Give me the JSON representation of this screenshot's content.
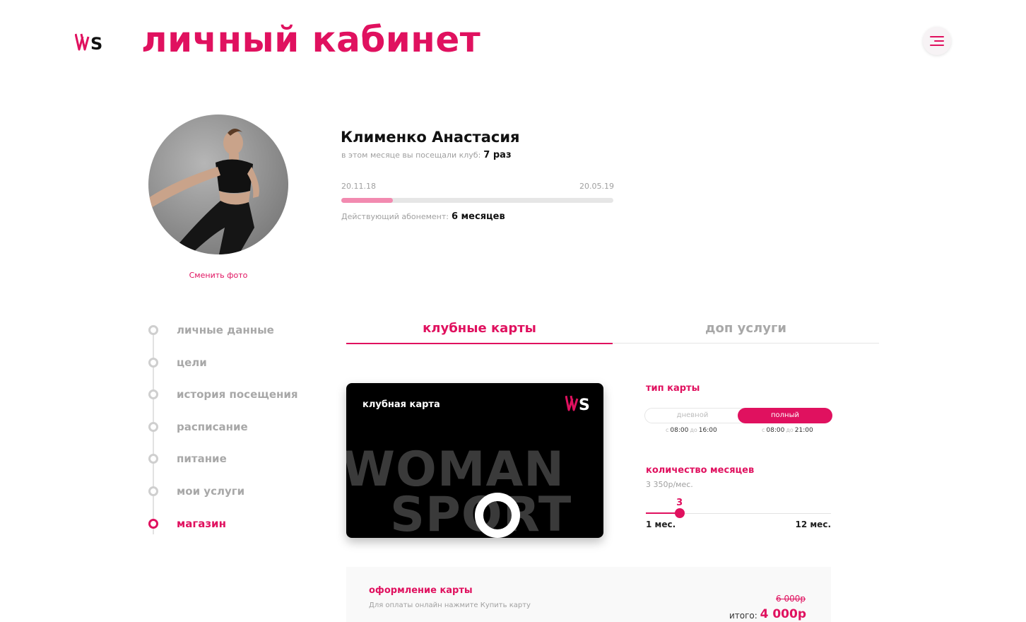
{
  "header": {
    "title": "личный кабинет",
    "logo_text": "WS"
  },
  "colors": {
    "accent": "#e0115f",
    "muted": "#a8a8a8",
    "progress_fill": "#f28ab0"
  },
  "profile": {
    "change_photo": "Сменить фото",
    "name": "Клименко Анастасия",
    "visits_label": "в этом месяце вы посещали клуб:",
    "visits_value": "7 раз",
    "date_start": "20.11.18",
    "date_end": "20.05.19",
    "progress_fraction": 0.19,
    "subscription_label": "Действующий абонемент:",
    "subscription_value": "6 месяцев"
  },
  "sidebar": {
    "items": [
      {
        "label": "личные данные",
        "active": false
      },
      {
        "label": "цели",
        "active": false
      },
      {
        "label": "история посещения",
        "active": false
      },
      {
        "label": "расписание",
        "active": false
      },
      {
        "label": "питание",
        "active": false
      },
      {
        "label": "мои услуги",
        "active": false
      },
      {
        "label": "магазин",
        "active": true
      }
    ]
  },
  "tabs": {
    "club_cards": "клубные карты",
    "extra_services": "доп услуги"
  },
  "card": {
    "title": "клубная карта",
    "brand_line1": "WOMAN",
    "brand_line2": "SPORT"
  },
  "card_type": {
    "title": "тип карты",
    "options": [
      {
        "label": "дневной",
        "from_prefix": "с",
        "from": "08:00",
        "to_prefix": "до",
        "to": "16:00",
        "selected": false
      },
      {
        "label": "полный",
        "from_prefix": "с",
        "from": "08:00",
        "to_prefix": "до",
        "to": "21:00",
        "selected": true
      }
    ]
  },
  "months": {
    "title": "количество месяцев",
    "price_per_month": "3 350р/мес.",
    "value": 3,
    "value_label": "3",
    "min": 1,
    "max": 12,
    "min_label": "1 мес.",
    "max_label": "12 мес."
  },
  "checkout": {
    "title": "оформление карты",
    "hint": "Для оплаты онлайн нажмите Купить карту",
    "old_price": "6 000р",
    "total_label": "итого:",
    "total_price": "4 000р"
  }
}
